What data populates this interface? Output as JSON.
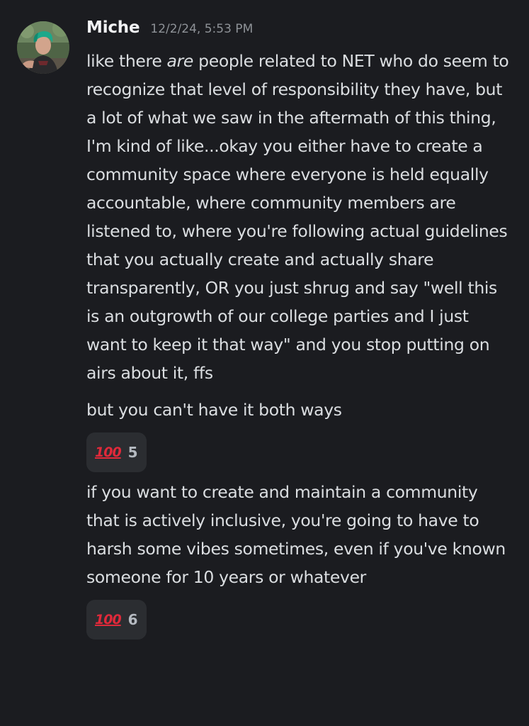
{
  "author": {
    "name": "Miche",
    "timestamp": "12/2/24, 5:53 PM"
  },
  "messages": [
    {
      "before_em": "like there ",
      "em": "are",
      "after_em": " people related to NET who do seem to recognize that level of responsibility they have, but a lot of what we saw in the aftermath of this thing, I'm kind of like...okay you either have to create a community space where everyone is held equally accountable, where community members are listened to, where you're following actual guidelines that you actually create and actually share transparently, OR you just shrug and say \"well this is an outgrowth of our college parties and I just want to keep it that way\" and you stop putting on airs about it, ffs"
    },
    {
      "text": "but you can't have it both ways",
      "reaction": {
        "emoji": "100",
        "emoji_icon": "hundred-points-icon",
        "count": "5"
      }
    },
    {
      "text": "if you want to create and maintain a community that is actively inclusive, you're going to have to harsh some vibes sometimes, even if you've known someone for 10 years or whatever",
      "reaction": {
        "emoji": "100",
        "emoji_icon": "hundred-points-icon",
        "count": "6"
      }
    }
  ],
  "colors": {
    "background": "#1b1c20",
    "text": "#dbdee1",
    "username": "#f2f3f5",
    "timestamp": "#8e9297",
    "reaction_bg": "#2b2d31",
    "emoji_red": "#e0293a"
  }
}
